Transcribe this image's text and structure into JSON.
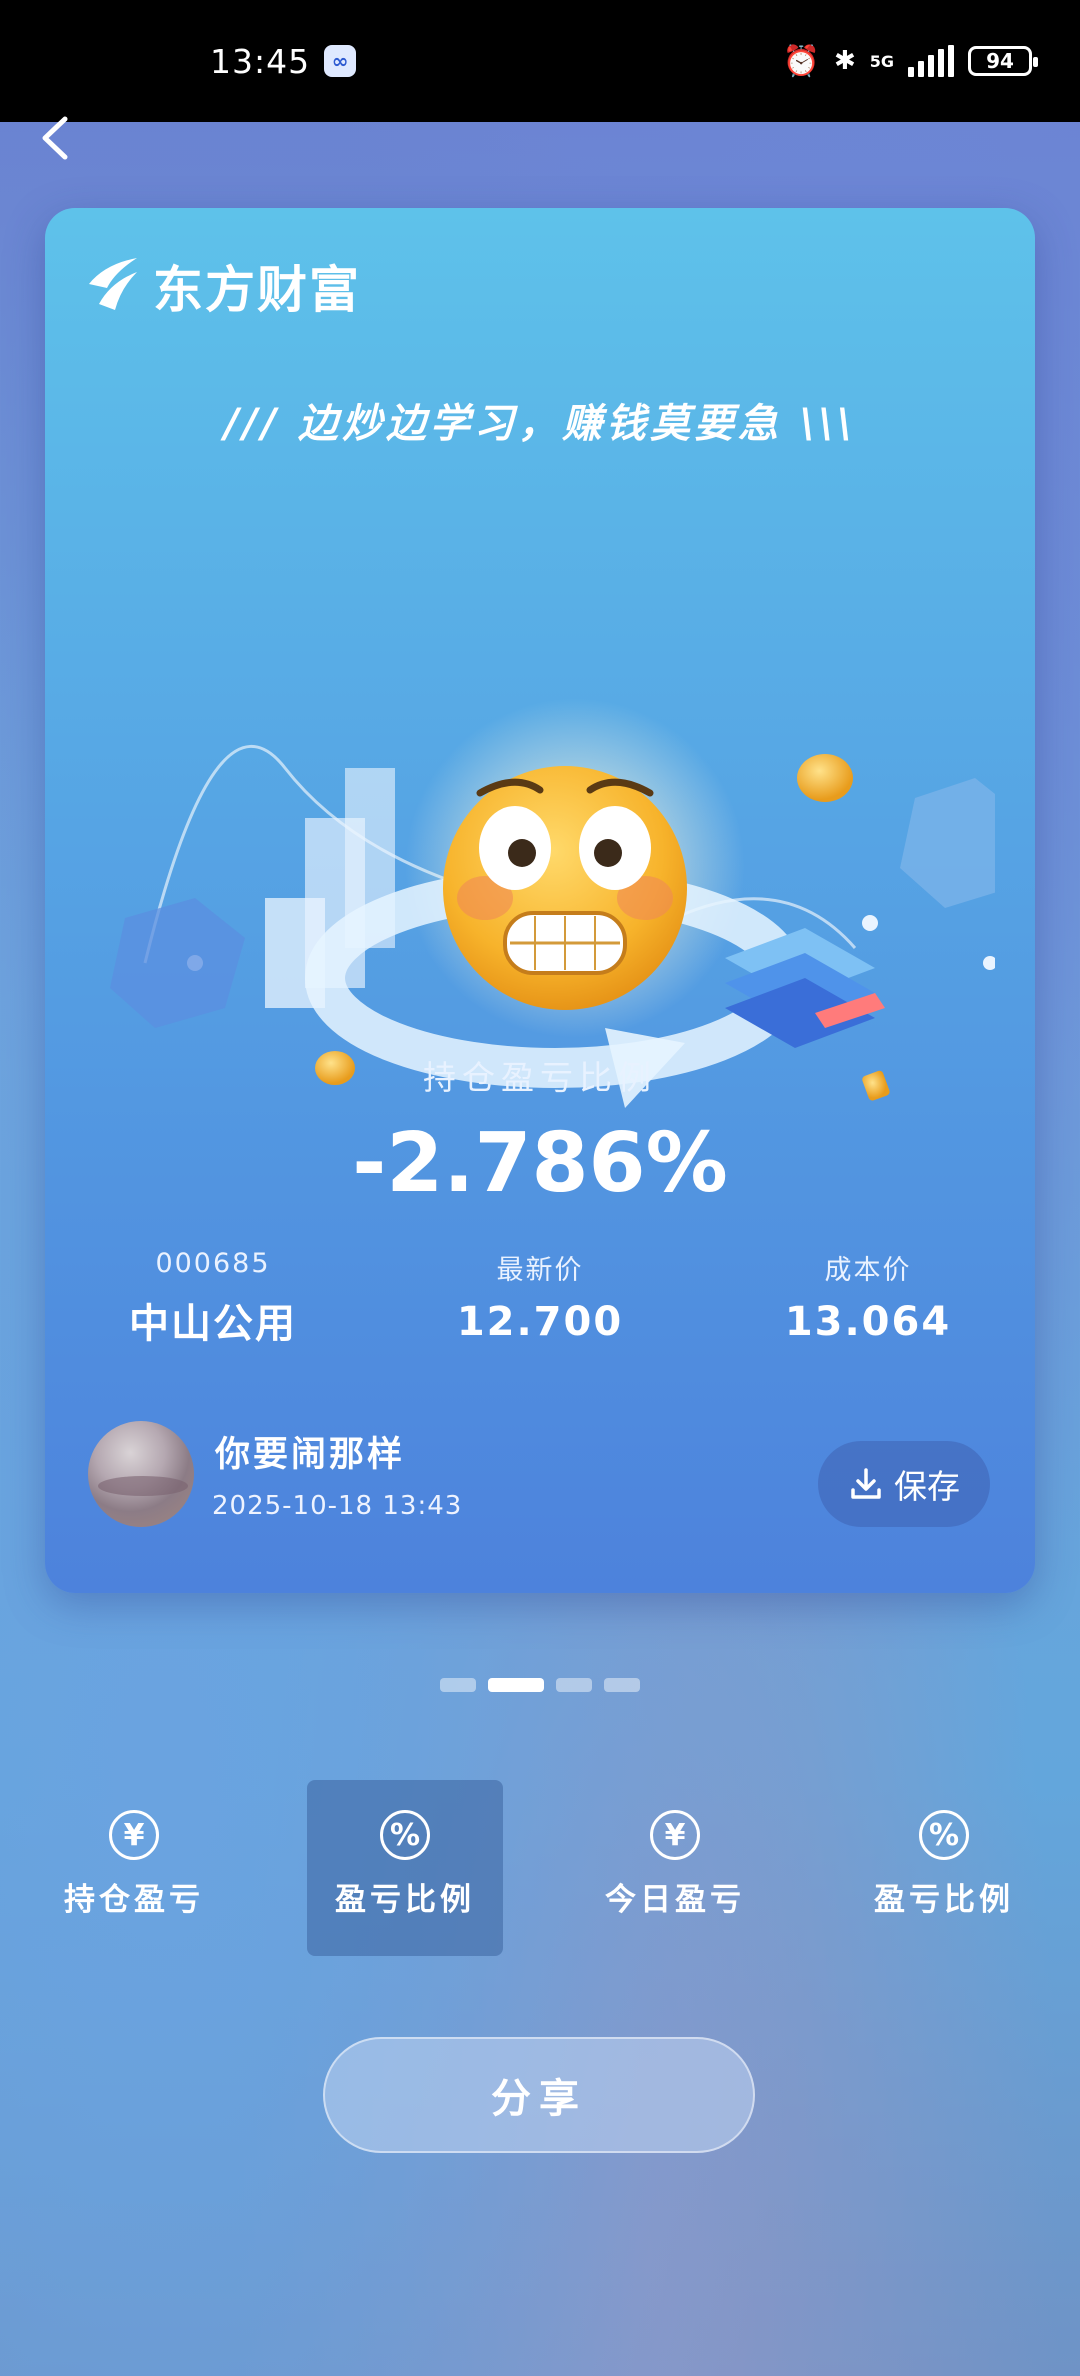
{
  "status_bar": {
    "time": "13:45",
    "battery": "94",
    "network": "5G"
  },
  "card": {
    "brand_name": "东方财富",
    "slogan": "/// 边炒边学习，赚钱莫要急 \\\\\\",
    "ratio_label": "持仓盈亏比例",
    "ratio_value": "-2.786%",
    "stock": {
      "code": "000685",
      "name": "中山公用"
    },
    "latest_price": {
      "label": "最新价",
      "value": "12.700"
    },
    "cost_price": {
      "label": "成本价",
      "value": "13.064"
    },
    "user": {
      "name": "你要闹那样",
      "datetime": "2025-10-18  13:43"
    },
    "save_label": "保存"
  },
  "pager": {
    "count": 4,
    "active": 1
  },
  "tabs": [
    {
      "label": "持仓盈亏",
      "icon": "¥",
      "icon_name": "yen-icon"
    },
    {
      "label": "盈亏比例",
      "icon": "%",
      "icon_name": "percent-icon"
    },
    {
      "label": "今日盈亏",
      "icon": "¥",
      "icon_name": "yen-icon"
    },
    {
      "label": "盈亏比例",
      "icon": "%",
      "icon_name": "percent-icon"
    }
  ],
  "selected_tab": 1,
  "share_label": "分享"
}
